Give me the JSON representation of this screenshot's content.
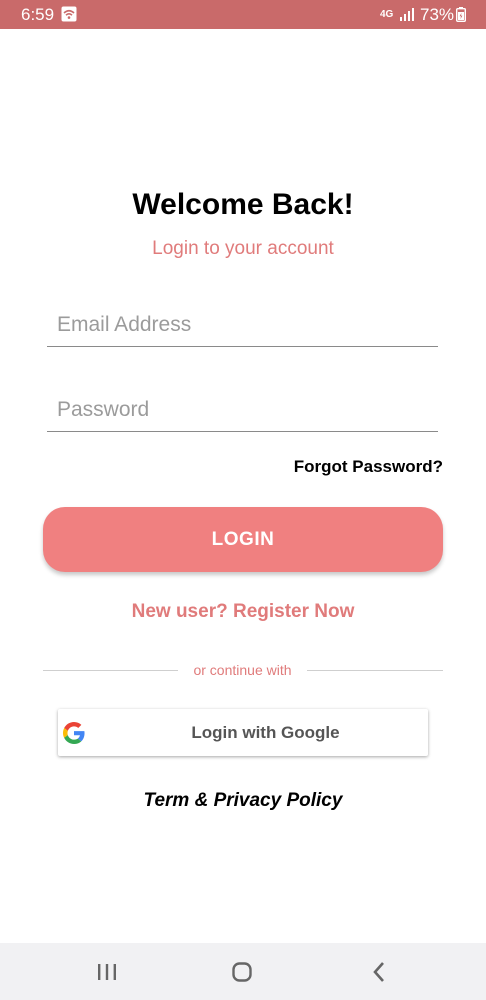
{
  "status_bar": {
    "time": "6:59",
    "network": "4G",
    "battery": "73%",
    "background_color": "#c96a6a",
    "icons": [
      "wifi-icon",
      "signal-icon",
      "battery-icon"
    ]
  },
  "login": {
    "title": "Welcome Back!",
    "subtitle": "Login to your account",
    "email_placeholder": "Email Address",
    "email_value": "",
    "password_placeholder": "Password",
    "password_value": "",
    "forgot_label": "Forgot Password?",
    "login_label": "LOGIN",
    "register_label": "New user? Register Now",
    "divider_label": "or continue with",
    "google_label": "Login with Google",
    "terms_label": "Term & Privacy Policy"
  },
  "nav_bar": {
    "icons": [
      "recent-apps-icon",
      "home-icon",
      "back-icon"
    ]
  },
  "colors": {
    "accent": "#f08080",
    "accent_text": "#e07b7b",
    "status_bar": "#c96a6a"
  }
}
